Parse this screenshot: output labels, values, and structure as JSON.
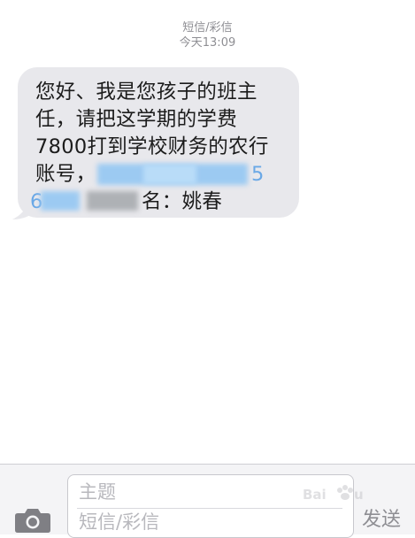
{
  "header": {
    "type_label": "短信/彩信",
    "timestamp": "今天13:09"
  },
  "message": {
    "lines": [
      "您好、我是您孩子的班主",
      "任，请把这学期的学费",
      "7800打到学校财务的农行",
      "账号，",
      "名：姚春"
    ],
    "line2_suffix_visible": "5",
    "line5_prefix_visible": "6"
  },
  "composer": {
    "subject_placeholder": "主题",
    "message_placeholder": "短信/彩信",
    "send_label": "发送"
  },
  "watermark": {
    "text": "Baidu经验"
  },
  "colors": {
    "bubble": "#e8e8ec",
    "meta_text": "#8e8e93",
    "redaction_blue": "#9ccaf2"
  }
}
